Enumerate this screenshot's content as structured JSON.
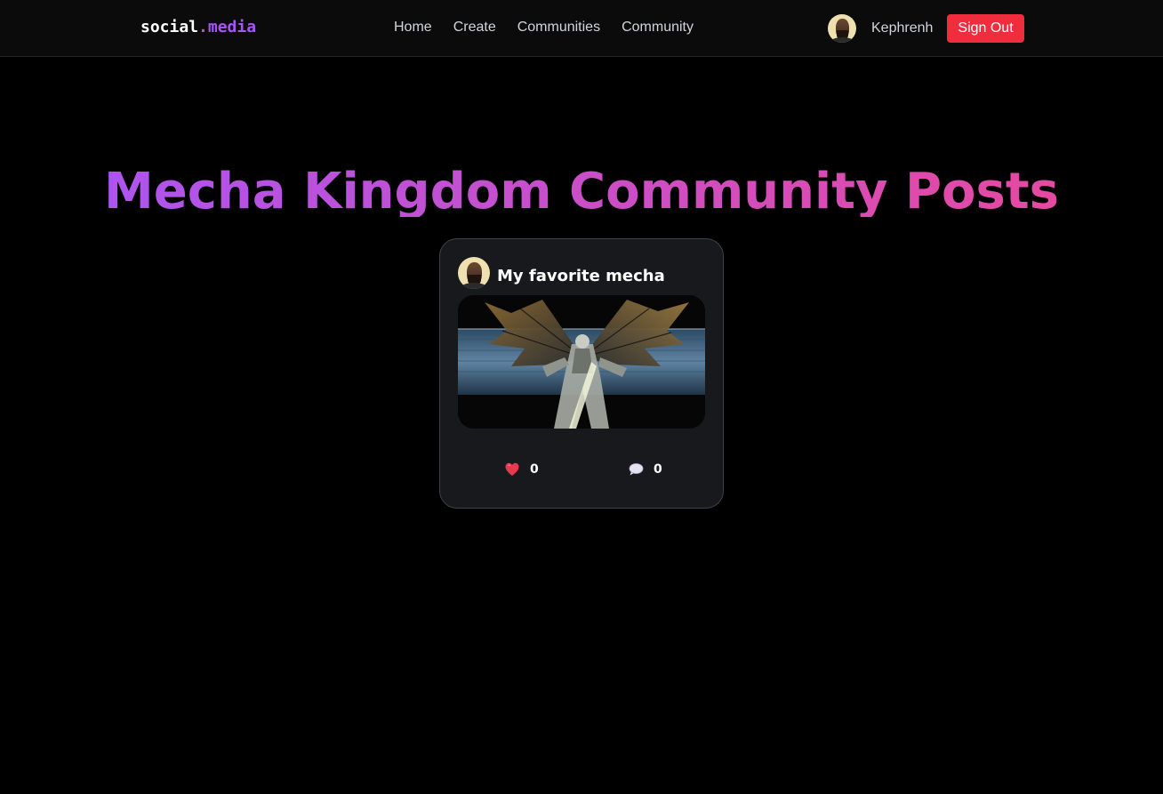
{
  "nav": {
    "logo_primary": "social",
    "logo_accent": ".media",
    "links": [
      {
        "label": "Home"
      },
      {
        "label": "Create"
      },
      {
        "label": "Communities"
      },
      {
        "label": "Community"
      }
    ],
    "username": "Kephrenh",
    "sign_out_label": "Sign Out"
  },
  "page": {
    "title": "Mecha Kingdom Community Posts"
  },
  "posts": [
    {
      "title": "My favorite mecha",
      "likes": "0",
      "comments": "0"
    }
  ],
  "colors": {
    "background": "#000000",
    "accent": "#a855f7",
    "title_gradient_start": "#a855f7",
    "title_gradient_end": "#ec4899",
    "sign_out_button": "#ef2d3d",
    "card_background": "#18191d"
  },
  "icons": {
    "like": "heart-icon",
    "comment": "speech-bubble-icon"
  }
}
